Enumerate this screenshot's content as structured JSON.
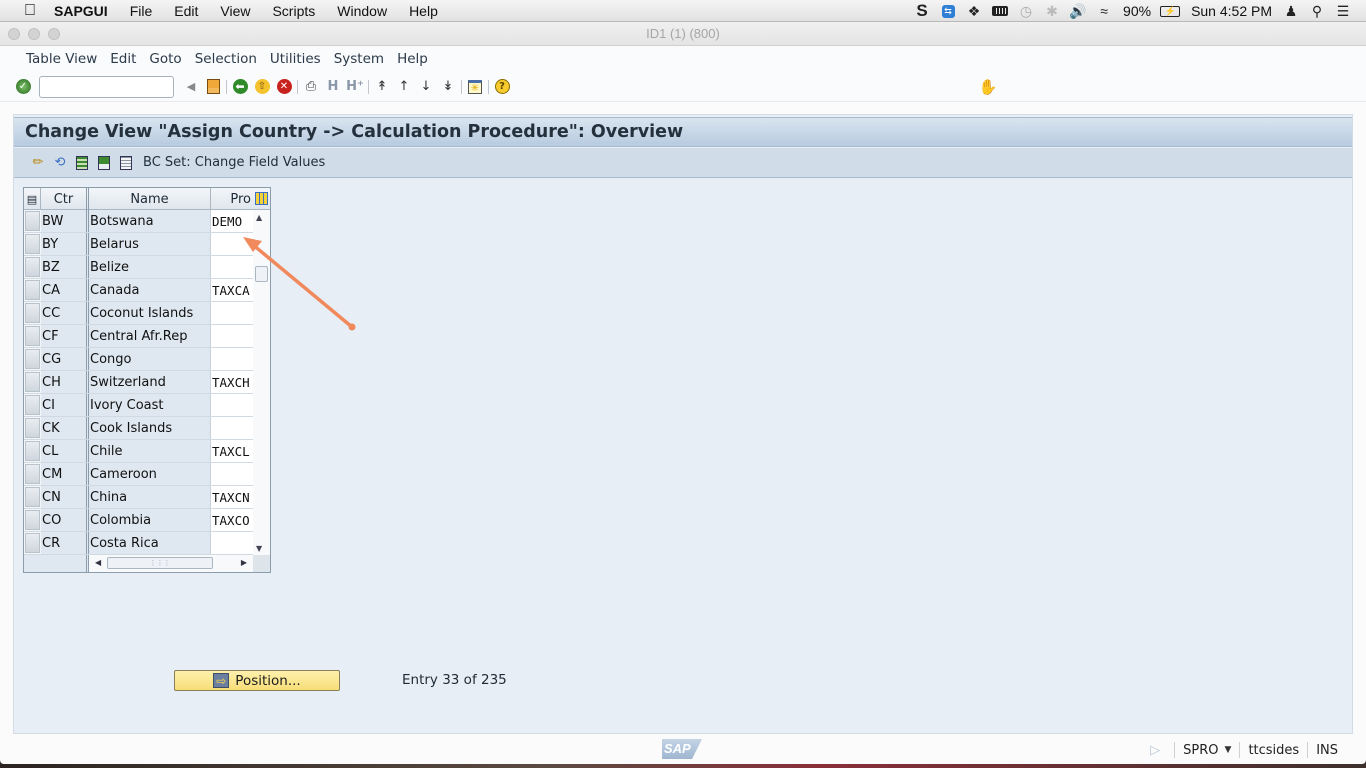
{
  "mac_menubar": {
    "app_name": "SAPGUI",
    "menus": [
      "File",
      "Edit",
      "View",
      "Scripts",
      "Window",
      "Help"
    ],
    "status_icons": [
      "skype-icon",
      "teamviewer-icon",
      "dropbox-icon",
      "keyboard-battery-icon",
      "time-machine-icon",
      "bluetooth-icon",
      "volume-icon",
      "wifi-icon"
    ],
    "battery": "90%",
    "clock": "Sun 4:52 PM"
  },
  "window": {
    "title": "ID1 (1) (800)"
  },
  "sap_menu": [
    "Table View",
    "Edit",
    "Goto",
    "Selection",
    "Utilities",
    "System",
    "Help"
  ],
  "toolbar": {
    "command_field_value": "",
    "buttons": [
      "enter",
      "save",
      "back",
      "exit",
      "cancel",
      "print",
      "find",
      "find-next",
      "first-page",
      "previous-page",
      "next-page",
      "last-page",
      "create-session",
      "help"
    ]
  },
  "page": {
    "title": "Change View \"Assign Country -> Calculation Procedure\": Overview",
    "app_toolbar": {
      "bc_set_label": "BC Set: Change Field Values"
    }
  },
  "table": {
    "columns": [
      "Ctr",
      "Name",
      "Pro"
    ],
    "rows": [
      {
        "ctr": "BW",
        "name": "Botswana",
        "pro": "DEMO"
      },
      {
        "ctr": "BY",
        "name": "Belarus",
        "pro": ""
      },
      {
        "ctr": "BZ",
        "name": "Belize",
        "pro": ""
      },
      {
        "ctr": "CA",
        "name": "Canada",
        "pro": "TAXCA"
      },
      {
        "ctr": "CC",
        "name": "Coconut Islands",
        "pro": ""
      },
      {
        "ctr": "CF",
        "name": "Central Afr.Rep",
        "pro": ""
      },
      {
        "ctr": "CG",
        "name": "Congo",
        "pro": ""
      },
      {
        "ctr": "CH",
        "name": "Switzerland",
        "pro": "TAXCH"
      },
      {
        "ctr": "CI",
        "name": "Ivory Coast",
        "pro": ""
      },
      {
        "ctr": "CK",
        "name": "Cook Islands",
        "pro": ""
      },
      {
        "ctr": "CL",
        "name": "Chile",
        "pro": "TAXCL"
      },
      {
        "ctr": "CM",
        "name": "Cameroon",
        "pro": ""
      },
      {
        "ctr": "CN",
        "name": "China",
        "pro": "TAXCN"
      },
      {
        "ctr": "CO",
        "name": "Colombia",
        "pro": "TAXCO"
      },
      {
        "ctr": "CR",
        "name": "Costa Rica",
        "pro": ""
      }
    ]
  },
  "annotation": {
    "arrow_color": "#f0895c"
  },
  "position_button": "Position...",
  "entry_info": "Entry 33 of 235",
  "statusbar": {
    "logo": "SAP",
    "transaction": "SPRO",
    "server": "ttcsides",
    "mode": "INS"
  }
}
